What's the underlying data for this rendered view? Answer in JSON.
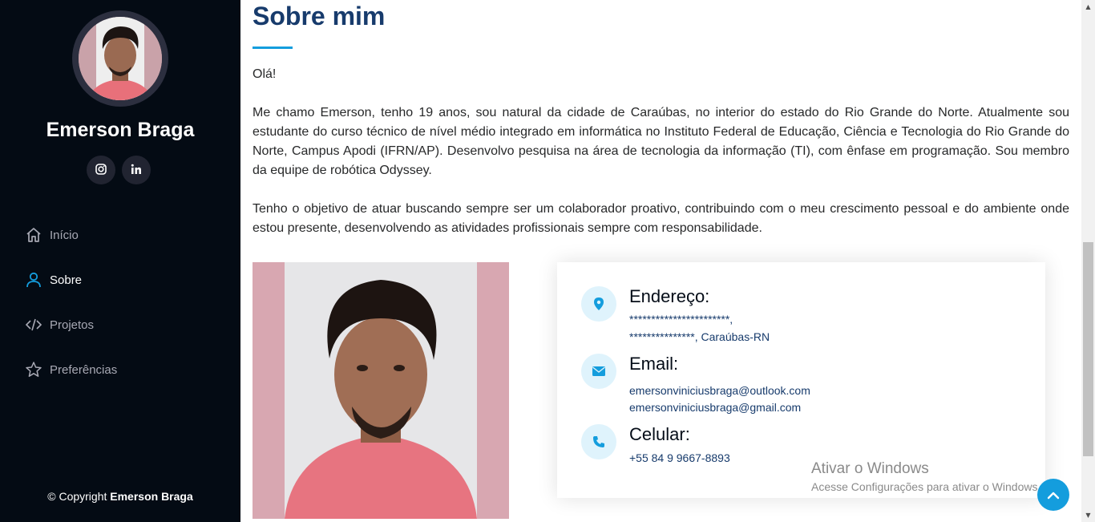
{
  "sidebar": {
    "name": "Emerson Braga",
    "social": [
      {
        "icon": "instagram-icon"
      },
      {
        "icon": "linkedin-icon"
      }
    ],
    "nav": [
      {
        "label": "Início",
        "icon": "home-icon",
        "active": false
      },
      {
        "label": "Sobre",
        "icon": "user-icon",
        "active": true
      },
      {
        "label": "Projetos",
        "icon": "code-icon",
        "active": false
      },
      {
        "label": "Preferências",
        "icon": "star-icon",
        "active": false
      }
    ],
    "copyright_prefix": "© Copyright",
    "copyright_name": "Emerson Braga"
  },
  "main": {
    "title": "Sobre mim",
    "greeting": "Olá!",
    "paragraph1": "Me chamo Emerson, tenho 19 anos, sou natural da cidade de Caraúbas, no interior do estado do Rio Grande do Norte. Atualmente sou estudante do curso técnico de nível médio integrado em informática no Instituto Federal de Educação, Ciência e Tecnologia do Rio Grande do Norte, Campus Apodi (IFRN/AP). Desenvolvo pesquisa na área de tecnologia da informação (TI), com ênfase em programação. Sou membro da equipe de robótica Odyssey.",
    "paragraph2": "Tenho o objetivo de atuar buscando sempre ser um colaborador proativo, contribuindo com o meu crescimento pessoal e do ambiente onde estou presente, desenvolvendo as atividades profissionais sempre com responsabilidade."
  },
  "info": {
    "address_heading": "Endereço:",
    "address_line1": "***********************,",
    "address_line2": "***************, Caraúbas-RN",
    "email_heading": "Email:",
    "email1": "emersonviniciusbraga@outlook.com",
    "email2": "emersonviniciusbraga@gmail.com",
    "phone_heading": "Celular:",
    "phone": "+55 84 9 9667-8893"
  },
  "watermark": {
    "line1": "Ativar o Windows",
    "line2": "Acesse Configurações para ativar o Windows."
  },
  "colors": {
    "sidebar_bg": "#040b14",
    "accent": "#149ddd",
    "heading": "#173b6c"
  }
}
